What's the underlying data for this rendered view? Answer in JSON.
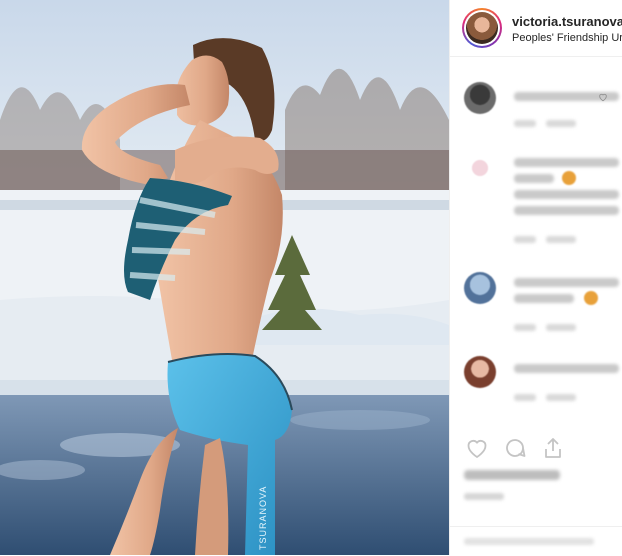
{
  "post": {
    "username": "victoria.tsuranova",
    "location": "Peoples' Friendship Ur",
    "towel_print": "TSURANOVA"
  },
  "icons": {
    "like": "heart-icon",
    "comment": "comment-bubble-icon",
    "share": "share-upload-icon",
    "comment_like": "small-heart-icon"
  },
  "colors": {
    "towel_blue": "#37a6d8",
    "text_dark": "#262626",
    "border": "#efefef",
    "badge_orange": "#e8a13a"
  }
}
